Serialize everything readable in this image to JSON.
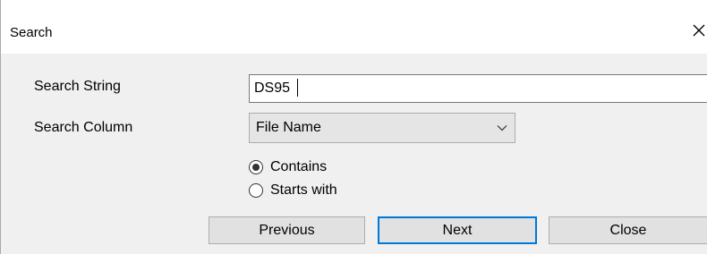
{
  "dialog": {
    "title": "Search",
    "close_glyph": "✕"
  },
  "search_string": {
    "label": "Search String",
    "value": "DS95"
  },
  "search_column": {
    "label": "Search Column",
    "selected": "File Name"
  },
  "match_mode": {
    "options": [
      {
        "label": "Contains",
        "checked": true
      },
      {
        "label": "Starts with",
        "checked": false
      }
    ]
  },
  "buttons": {
    "previous": "Previous",
    "next": "Next",
    "close": "Close"
  },
  "colors": {
    "focus_accent": "#0078d7",
    "dialog_background": "#f0f0f0",
    "button_face": "#e1e1e1"
  },
  "icons": [
    "close-icon",
    "chevron-down-icon",
    "radio-selected-icon",
    "radio-unselected-icon"
  ]
}
